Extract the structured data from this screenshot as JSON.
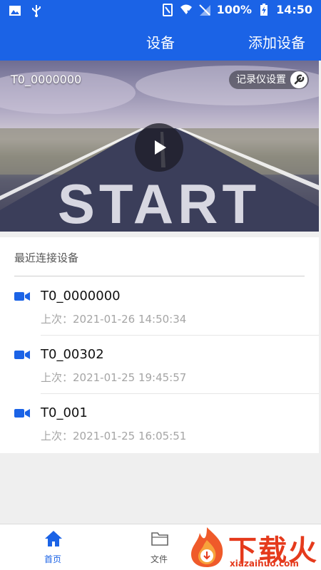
{
  "status_bar": {
    "battery": "100%",
    "time": "14:50"
  },
  "app_bar": {
    "title": "设备",
    "action": "添加设备"
  },
  "hero": {
    "device_name": "T0_0000000",
    "recorder_settings": "记录仪设置",
    "road_text": "START"
  },
  "recent": {
    "title": "最近连接设备",
    "items": [
      {
        "name": "T0_0000000",
        "time": "上次：2021-01-26 14:50:34"
      },
      {
        "name": "T0_00302",
        "time": "上次：2021-01-25 19:45:57"
      },
      {
        "name": "T0_001",
        "time": "上次：2021-01-25 16:05:51"
      }
    ]
  },
  "bottom_nav": {
    "home": "首页",
    "files": "文件"
  },
  "watermark": {
    "text": "下载火",
    "sub": "xiazaihuo.com"
  },
  "colors": {
    "primary": "#1b63e6",
    "watermark": "#e53a1c"
  }
}
